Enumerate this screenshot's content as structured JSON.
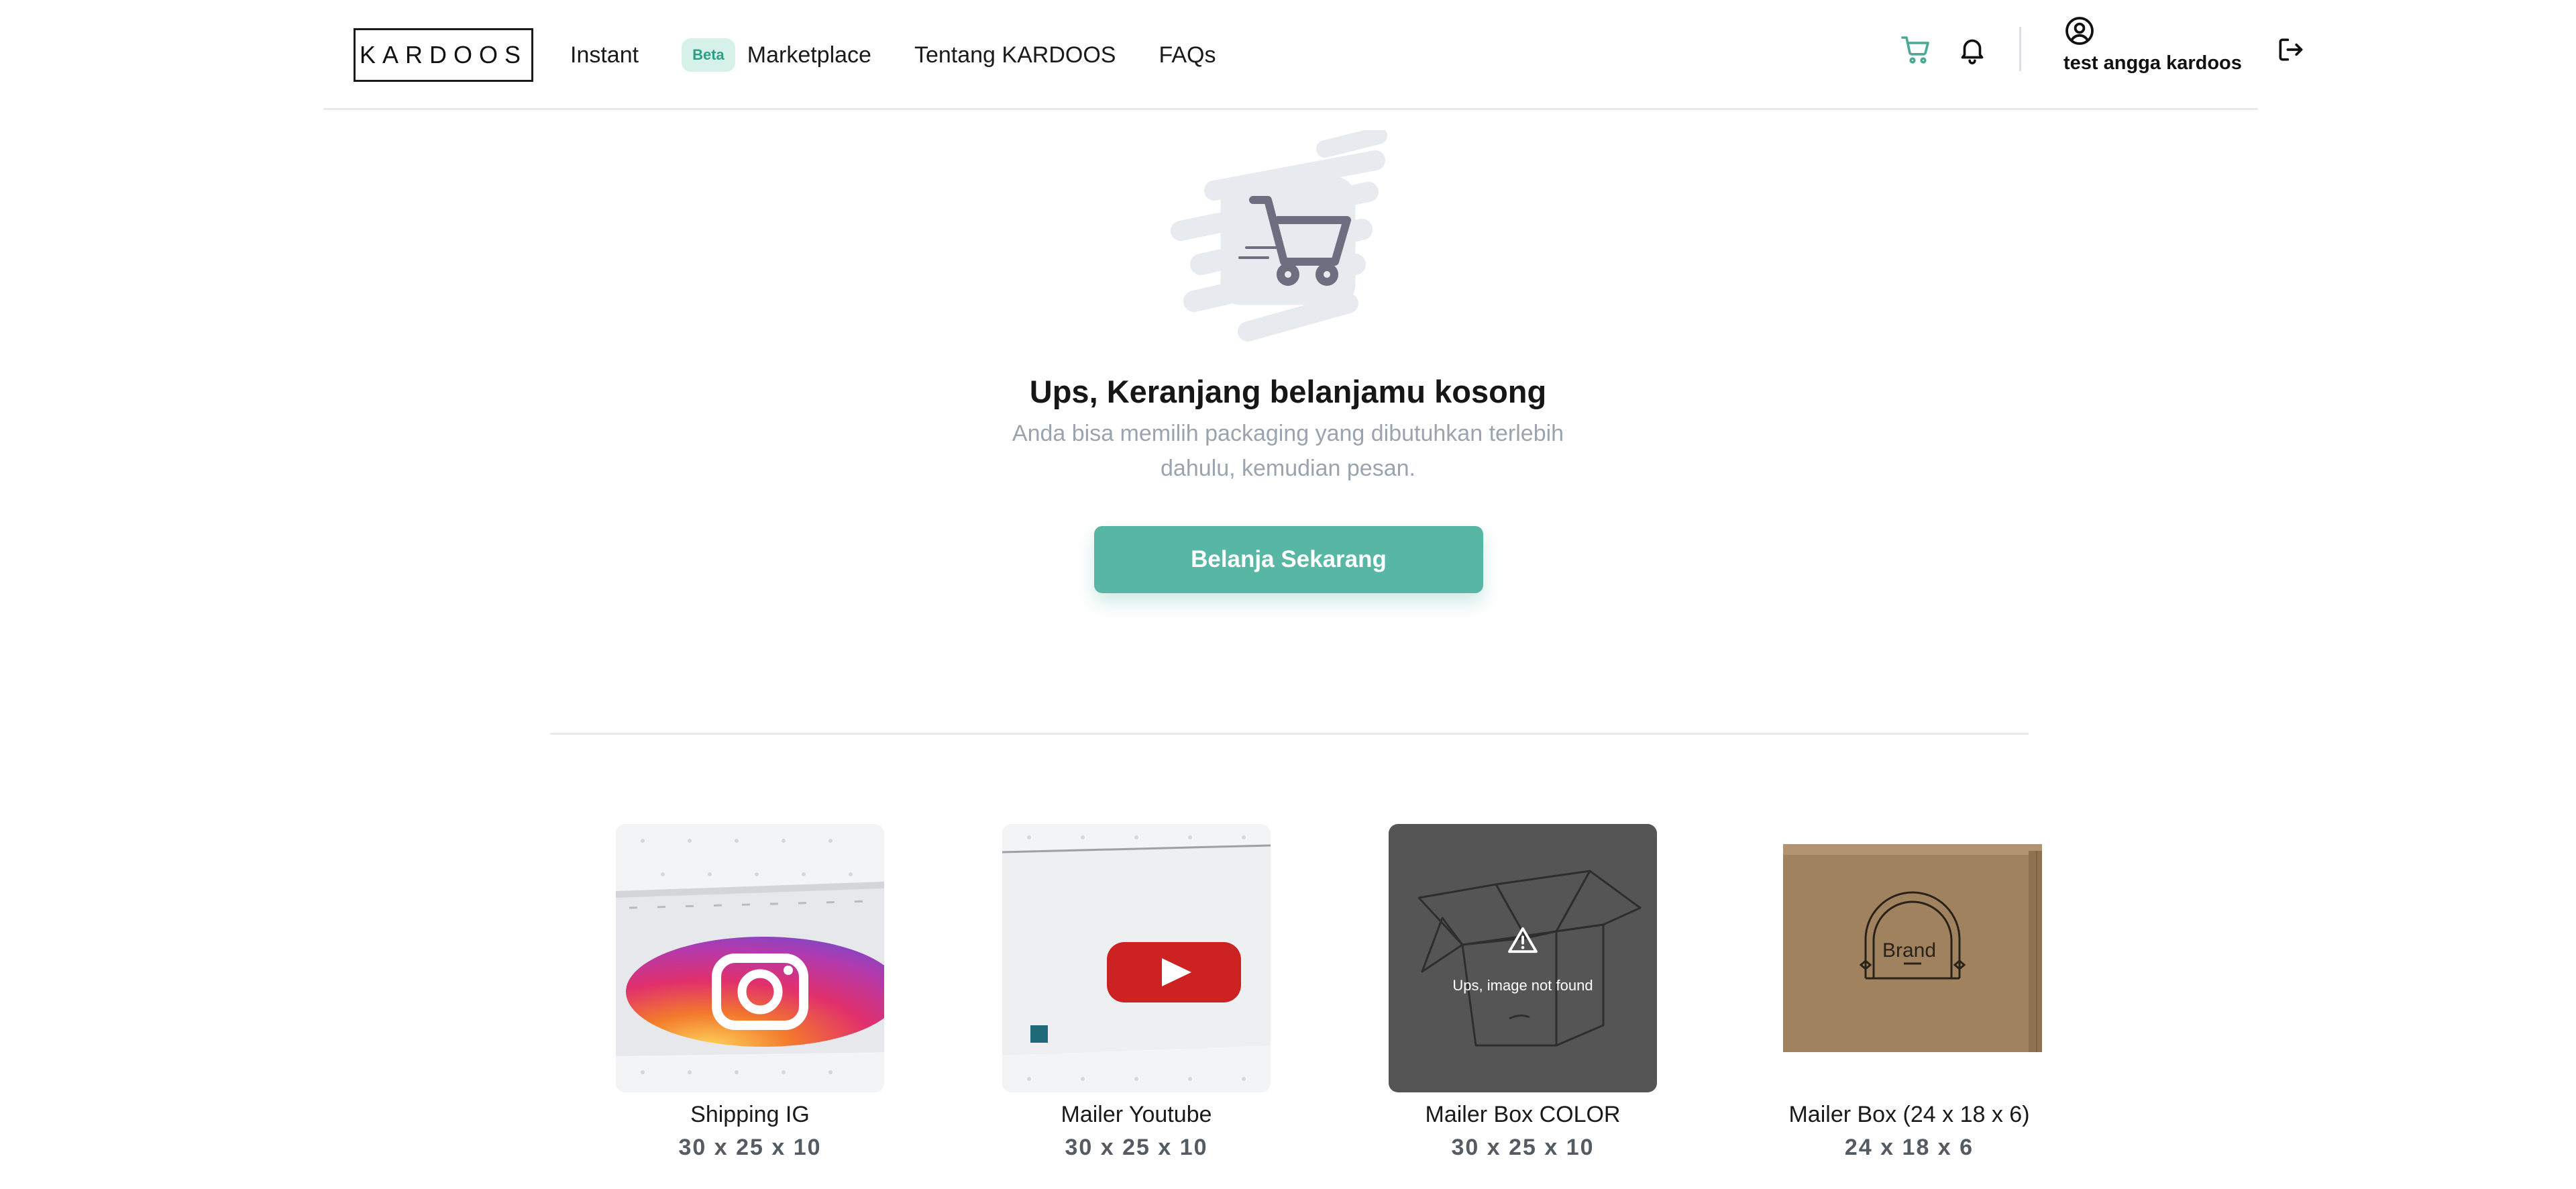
{
  "header": {
    "logo": "KARDOOS",
    "nav": [
      {
        "label": "Instant"
      },
      {
        "label": "Marketplace",
        "badge": "Beta"
      },
      {
        "label": "Tentang KARDOOS"
      },
      {
        "label": "FAQs"
      }
    ],
    "user_name": "test angga kardoos",
    "icons": [
      "cart-icon",
      "bell-icon",
      "user-circle-icon",
      "logout-icon"
    ],
    "accent_color": "#4aa894"
  },
  "empty_cart": {
    "title": "Ups, Keranjang belanjamu kosong",
    "description": "Anda bisa memilih packaging yang dibutuhkan terlebih dahulu, kemudian pesan.",
    "cta_label": "Belanja Sekarang",
    "cta_color": "#58b7a4"
  },
  "products": [
    {
      "name": "Shipping IG",
      "dimensions": "30 x 25 x 10",
      "image": "instagram-box-image"
    },
    {
      "name": "Mailer Youtube",
      "dimensions": "30 x 25 x 10",
      "image": "youtube-box-image"
    },
    {
      "name": "Mailer Box COLOR",
      "dimensions": "30 x 25 x 10",
      "image": "image-not-found",
      "image_error": "Ups, image not found"
    },
    {
      "name": "Mailer Box (24 x 18 x 6)",
      "dimensions": "24 x 18 x 6",
      "image": "kraft-box-image",
      "brand_text": "Brand"
    }
  ]
}
